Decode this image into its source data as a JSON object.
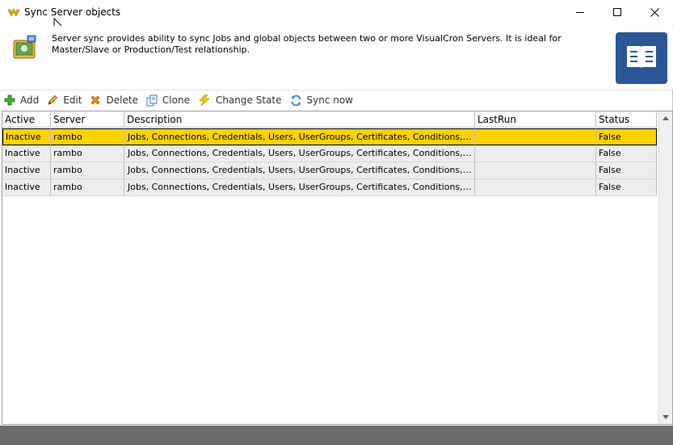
{
  "window": {
    "title": "Sync Server objects",
    "controls": {
      "minimize": "minimize-icon",
      "maximize": "maximize-icon",
      "close": "close-icon"
    }
  },
  "header": {
    "description": "Server sync provides ability to sync Jobs and global objects between two or more VisualCron Servers. It is ideal for Master/Slave or Production/Test relationship.",
    "icon": "server-sync-icon",
    "help_icon": "book-icon",
    "help_color": "#2b5797"
  },
  "toolbar": {
    "add_label": "Add",
    "edit_label": "Edit",
    "delete_label": "Delete",
    "clone_label": "Clone",
    "change_state_label": "Change State",
    "sync_now_label": "Sync now"
  },
  "grid": {
    "columns": [
      "Active",
      "Server",
      "Description",
      "LastRun",
      "Status"
    ],
    "rows": [
      {
        "active": "Inactive",
        "server": "rambo",
        "description": "Jobs, Connections, Credentials, Users, UserGroups, Certificates, Conditions, Netwo...",
        "lastrun": "",
        "status": "False"
      },
      {
        "active": "Inactive",
        "server": "rambo",
        "description": "Jobs, Connections, Credentials, Users, UserGroups, Certificates, Conditions, Netwo...",
        "lastrun": "",
        "status": "False"
      },
      {
        "active": "Inactive",
        "server": "rambo",
        "description": "Jobs, Connections, Credentials, Users, UserGroups, Certificates, Conditions, Netwo...",
        "lastrun": "",
        "status": "False"
      },
      {
        "active": "Inactive",
        "server": "rambo",
        "description": "Jobs, Connections, Credentials, Users, UserGroups, Certificates, Conditions, Netwo...",
        "lastrun": "",
        "status": "False"
      }
    ],
    "selected_color": "#ffd200"
  }
}
